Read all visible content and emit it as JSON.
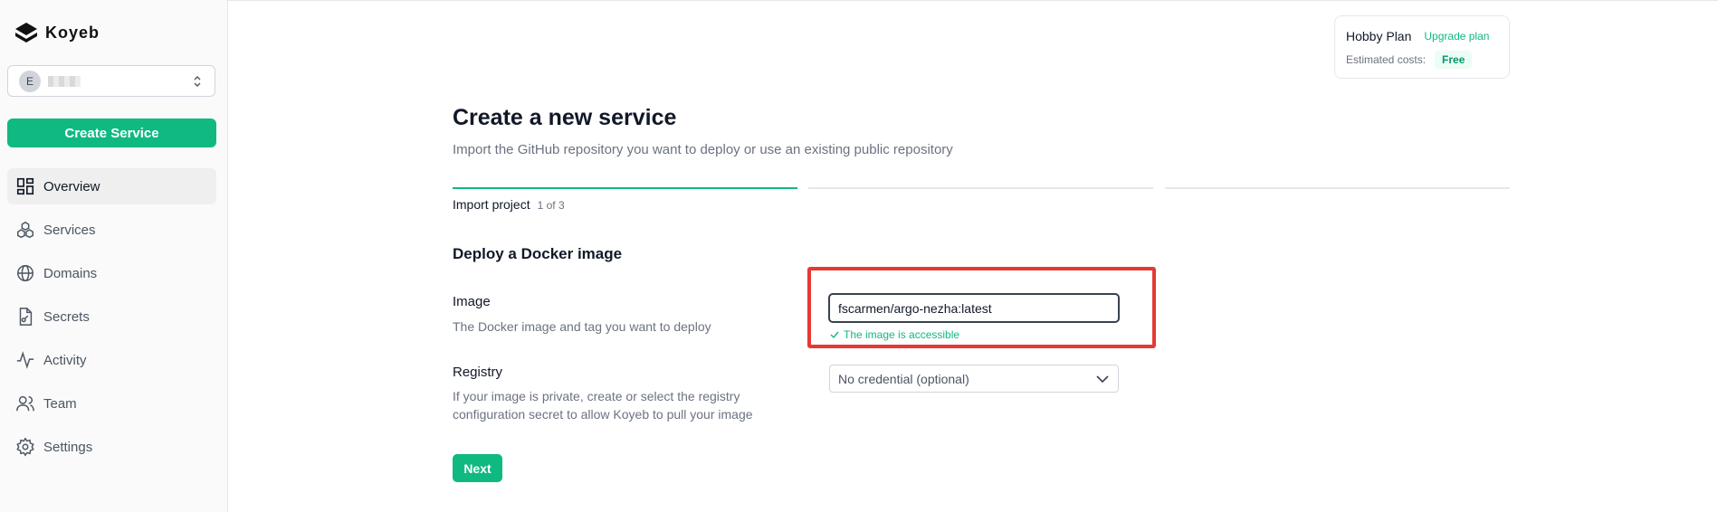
{
  "sidebar": {
    "brand": "Koyeb",
    "org": {
      "avatar_initial": "E"
    },
    "create_service_label": "Create Service",
    "nav": [
      {
        "label": "Overview",
        "icon": "dashboard-icon",
        "active": true
      },
      {
        "label": "Services",
        "icon": "cubes-icon",
        "active": false
      },
      {
        "label": "Domains",
        "icon": "globe-icon",
        "active": false
      },
      {
        "label": "Secrets",
        "icon": "file-key-icon",
        "active": false
      },
      {
        "label": "Activity",
        "icon": "pulse-icon",
        "active": false
      },
      {
        "label": "Team",
        "icon": "users-icon",
        "active": false
      },
      {
        "label": "Settings",
        "icon": "gear-icon",
        "active": false
      }
    ]
  },
  "plan": {
    "name": "Hobby Plan",
    "upgrade_label": "Upgrade plan",
    "estimated_label": "Estimated costs:",
    "cost_badge": "Free"
  },
  "main": {
    "title": "Create a new service",
    "subtitle": "Import the GitHub repository you want to deploy or use an existing public repository",
    "step": {
      "label": "Import project",
      "count": "1 of 3"
    },
    "section_title": "Deploy a Docker image",
    "image": {
      "label": "Image",
      "help": "The Docker image and tag you want to deploy",
      "value": "fscarmen/argo-nezha:latest",
      "status": "The image is accessible"
    },
    "registry": {
      "label": "Registry",
      "help_line1": "If your image is private, create or select the registry",
      "help_line2": "configuration secret to allow Koyeb to pull your image",
      "selected": "No credential (optional)"
    },
    "next_label": "Next"
  },
  "colors": {
    "accent": "#10b981",
    "highlight": "#e53935"
  }
}
